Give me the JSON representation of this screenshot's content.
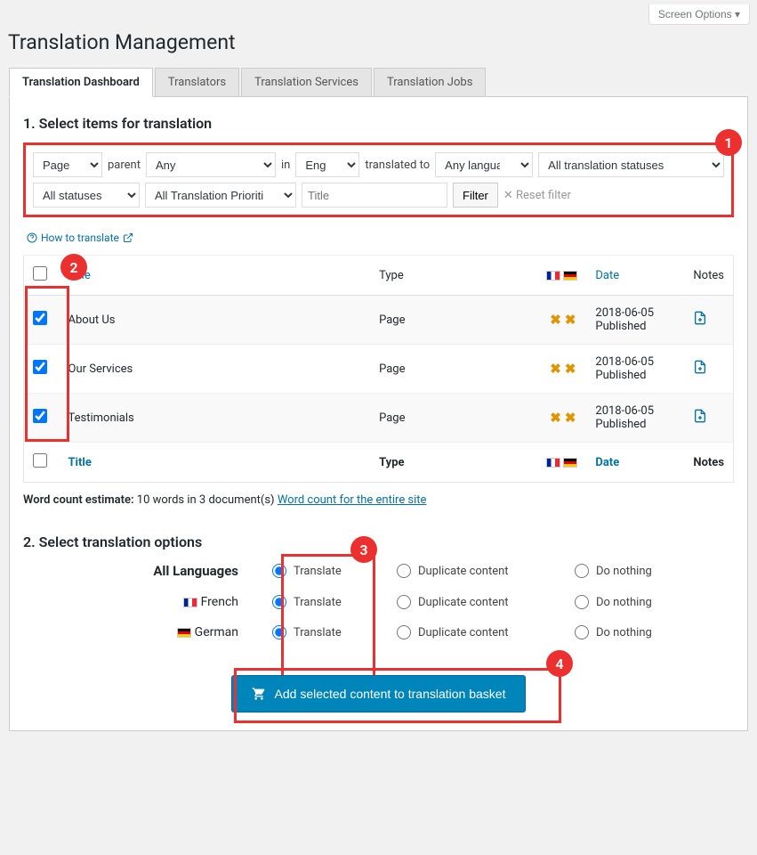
{
  "screen_options_label": "Screen Options",
  "page_title": "Translation Management",
  "tabs": [
    {
      "label": "Translation Dashboard",
      "active": true
    },
    {
      "label": "Translators"
    },
    {
      "label": "Translation Services"
    },
    {
      "label": "Translation Jobs"
    }
  ],
  "section1_title": "1. Select items for translation",
  "filters": {
    "type": "Page",
    "parent_label": "parent",
    "parent_value": "Any",
    "in_label": "in",
    "language": "English",
    "translated_to_label": "translated to",
    "target_lang": "Any language",
    "translation_status": "All translation statuses",
    "status": "All statuses",
    "priority": "All Translation Priorities",
    "title_placeholder": "Title",
    "filter_btn": "Filter",
    "reset_label": "Reset filter"
  },
  "how_to_label": "How to translate",
  "table": {
    "headers": {
      "title": "Title",
      "type": "Type",
      "date": "Date",
      "notes": "Notes"
    },
    "rows": [
      {
        "title": "About Us",
        "type": "Page",
        "date": "2018-06-05",
        "status": "Published",
        "checked": true
      },
      {
        "title": "Our Services",
        "type": "Page",
        "date": "2018-06-05",
        "status": "Published",
        "checked": true
      },
      {
        "title": "Testimonials",
        "type": "Page",
        "date": "2018-06-05",
        "status": "Published",
        "checked": true
      }
    ]
  },
  "word_count_label": "Word count estimate:",
  "word_count_text": "10 words in 3 document(s)",
  "word_count_link": "Word count for the entire site",
  "section2_title": "2. Select translation options",
  "options": {
    "all_label": "All Languages",
    "translate_label": "Translate",
    "duplicate_label": "Duplicate content",
    "nothing_label": "Do nothing",
    "languages": [
      {
        "name": "French",
        "flag": "fr"
      },
      {
        "name": "German",
        "flag": "de"
      }
    ]
  },
  "submit_label": "Add selected content to translation basket",
  "callouts": {
    "1": "1",
    "2": "2",
    "3": "3",
    "4": "4"
  }
}
